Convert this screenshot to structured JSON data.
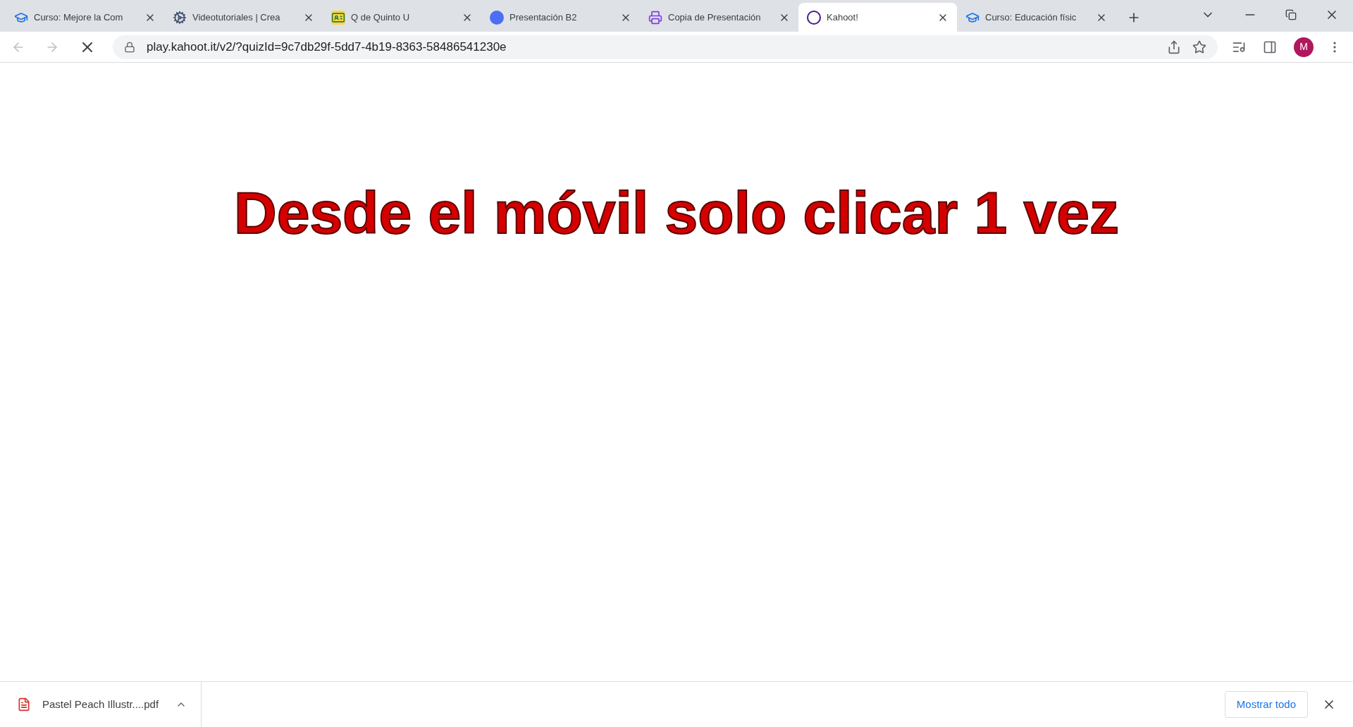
{
  "tabs": [
    {
      "title": "Curso: Mejore la Com",
      "kind": "cap",
      "selected": false
    },
    {
      "title": "Videotutoriales | Crea",
      "kind": "gear",
      "selected": false
    },
    {
      "title": "Q de Quinto U",
      "kind": "card",
      "selected": false
    },
    {
      "title": "Presentación B2",
      "kind": "circle",
      "selected": false
    },
    {
      "title": "Copia de Presentación",
      "kind": "printer",
      "selected": false
    },
    {
      "title": "Kahoot!",
      "kind": "k",
      "selected": true
    },
    {
      "title": "Curso: Educación físic",
      "kind": "cap",
      "selected": false
    }
  ],
  "address_bar": {
    "url": "play.kahoot.it/v2/?quizId=9c7db29f-5dd7-4b19-8363-58486541230e"
  },
  "profile": {
    "initial": "M"
  },
  "page": {
    "message": "Desde el móvil solo clicar 1 vez"
  },
  "download_bar": {
    "file": "Pastel Peach Illustr....pdf",
    "show_all": "Mostrar todo"
  }
}
